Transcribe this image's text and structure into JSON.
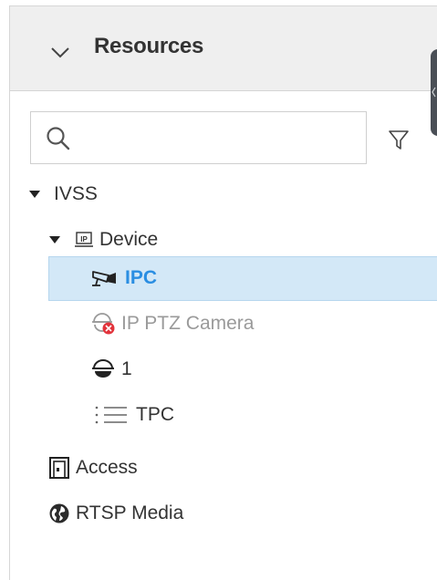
{
  "resources_panel": {
    "title": "Resources",
    "search": {
      "value": "",
      "placeholder": ""
    },
    "tree": {
      "root": {
        "label": "IVSS"
      },
      "device_group": {
        "label": "Device"
      },
      "devices": [
        {
          "label": "IPC",
          "icon": "bullet-camera-icon",
          "selected": true
        },
        {
          "label": "IP PTZ Camera",
          "icon": "ptz-camera-offline-icon",
          "offline": true
        },
        {
          "label": "1",
          "icon": "dome-camera-icon"
        },
        {
          "label": "TPC",
          "icon": "list-icon"
        }
      ],
      "access": {
        "label": "Access",
        "icon": "door-access-icon"
      },
      "rtsp_media": {
        "label": "RTSP Media",
        "icon": "globe-icon"
      }
    }
  },
  "colors": {
    "header_bg": "#efefef",
    "selected_bg": "#d3e8f7",
    "selected_text": "#2a8ee2",
    "offline_badge": "#e2333b",
    "disabled_text": "#9a9a9a"
  }
}
